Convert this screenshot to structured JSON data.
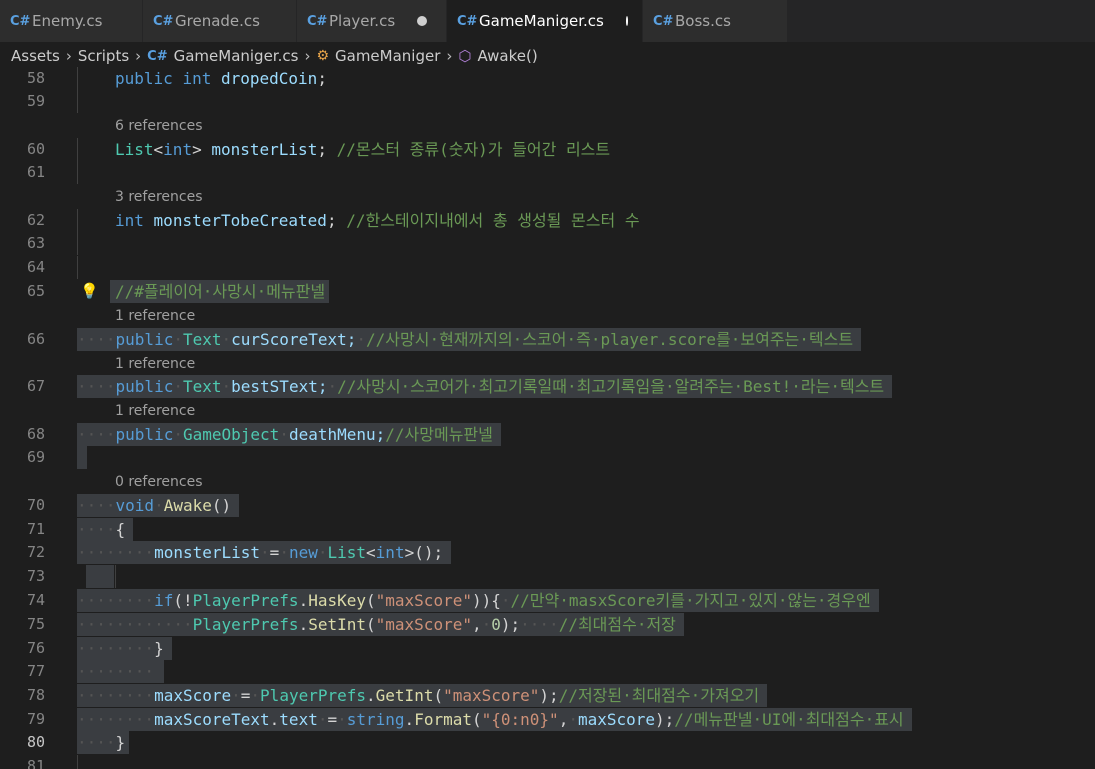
{
  "tabs": [
    {
      "label": "Enemy.cs",
      "icon": "csharp-file-icon",
      "modified": false,
      "active": false
    },
    {
      "label": "Grenade.cs",
      "icon": "csharp-file-icon",
      "modified": false,
      "active": false
    },
    {
      "label": "Player.cs",
      "icon": "csharp-file-icon",
      "modified": true,
      "active": false
    },
    {
      "label": "GameManiger.cs",
      "icon": "csharp-file-icon",
      "modified": true,
      "active": true
    },
    {
      "label": "Boss.cs",
      "icon": "csharp-file-icon",
      "modified": false,
      "active": false
    }
  ],
  "breadcrumb": {
    "assets": "Assets",
    "scripts": "Scripts",
    "file": "GameManiger.cs",
    "class": "GameManiger",
    "method": "Awake()"
  },
  "lenses": {
    "l60": "6 references",
    "l62": "3 references",
    "l66": "1 reference",
    "l67": "1 reference",
    "l68": "1 reference",
    "l70": "0 references"
  },
  "lines": {
    "n58": "58",
    "n59": "59",
    "n60": "60",
    "n61": "61",
    "n62": "62",
    "n63": "63",
    "n64": "64",
    "n65": "65",
    "n66": "66",
    "n67": "67",
    "n68": "68",
    "n69": "69",
    "n70": "70",
    "n71": "71",
    "n72": "72",
    "n73": "73",
    "n74": "74",
    "n75": "75",
    "n76": "76",
    "n77": "77",
    "n78": "78",
    "n79": "79",
    "n80": "80",
    "n81": "81"
  },
  "code": {
    "public": "public",
    "int": "int",
    "dropedCoin": "dropedCoin",
    "semi": ";",
    "List": "List",
    "lt": "<",
    "gt": ">",
    "monsterList": "monsterList",
    "c60": "//몬스터 종류(숫자)가 들어간 리스트",
    "monsterTobeCreated": "monsterTobeCreated",
    "c62": "//한스테이지내에서 총 생성될 몬스터 수",
    "c65": "//#플레이어·사망시·메뉴판넬",
    "Text": "Text",
    "curScoreText": "curScoreText;",
    "c66": "//사망시·현재까지의·스코어·즉·player.score를·보여주는·텍스트",
    "bestSText": "bestSText;",
    "c67": "//사망시·스코어가·최고기록일때·최고기록임을·알려주는·Best!·라는·텍스트",
    "GameObject": "GameObject",
    "deathMenu": "deathMenu;",
    "c68": "//사망메뉴판넬",
    "void": "void",
    "Awake": "Awake",
    "parens": "()",
    "lbrace": "{",
    "rbrace": "}",
    "eq": "=",
    "new": "new",
    "close72": "();",
    "if": "if",
    "ifopen": "(!",
    "PlayerPrefs": "PlayerPrefs",
    "HasKey": "HasKey",
    "maxScoreStr": "\"maxScore\"",
    "ifclose": ")){",
    "c74": "//만약·masxScore키를·가지고·있지·않는·경우엔",
    "SetInt": "SetInt",
    "zero": "0",
    "c75": "//최대점수·저장",
    "maxScore": "maxScore",
    "GetInt": "GetInt",
    "c78": "//저장된·최대점수·가져오기",
    "maxScoreText": "maxScoreText",
    "textProp": "text",
    "string": "string",
    "Format": "Format",
    "fmtStr": "\"{0:n0}\"",
    "c79": "//메뉴판넬·UI에·최대점수·표시"
  },
  "colors": {
    "keyword": "#569cd6",
    "type": "#4ec9b0",
    "method": "#dcdcaa",
    "variable": "#9cdcfe",
    "comment": "#6a9955",
    "string": "#ce9178",
    "number": "#b5cea8",
    "selection": "#3a3d41"
  }
}
